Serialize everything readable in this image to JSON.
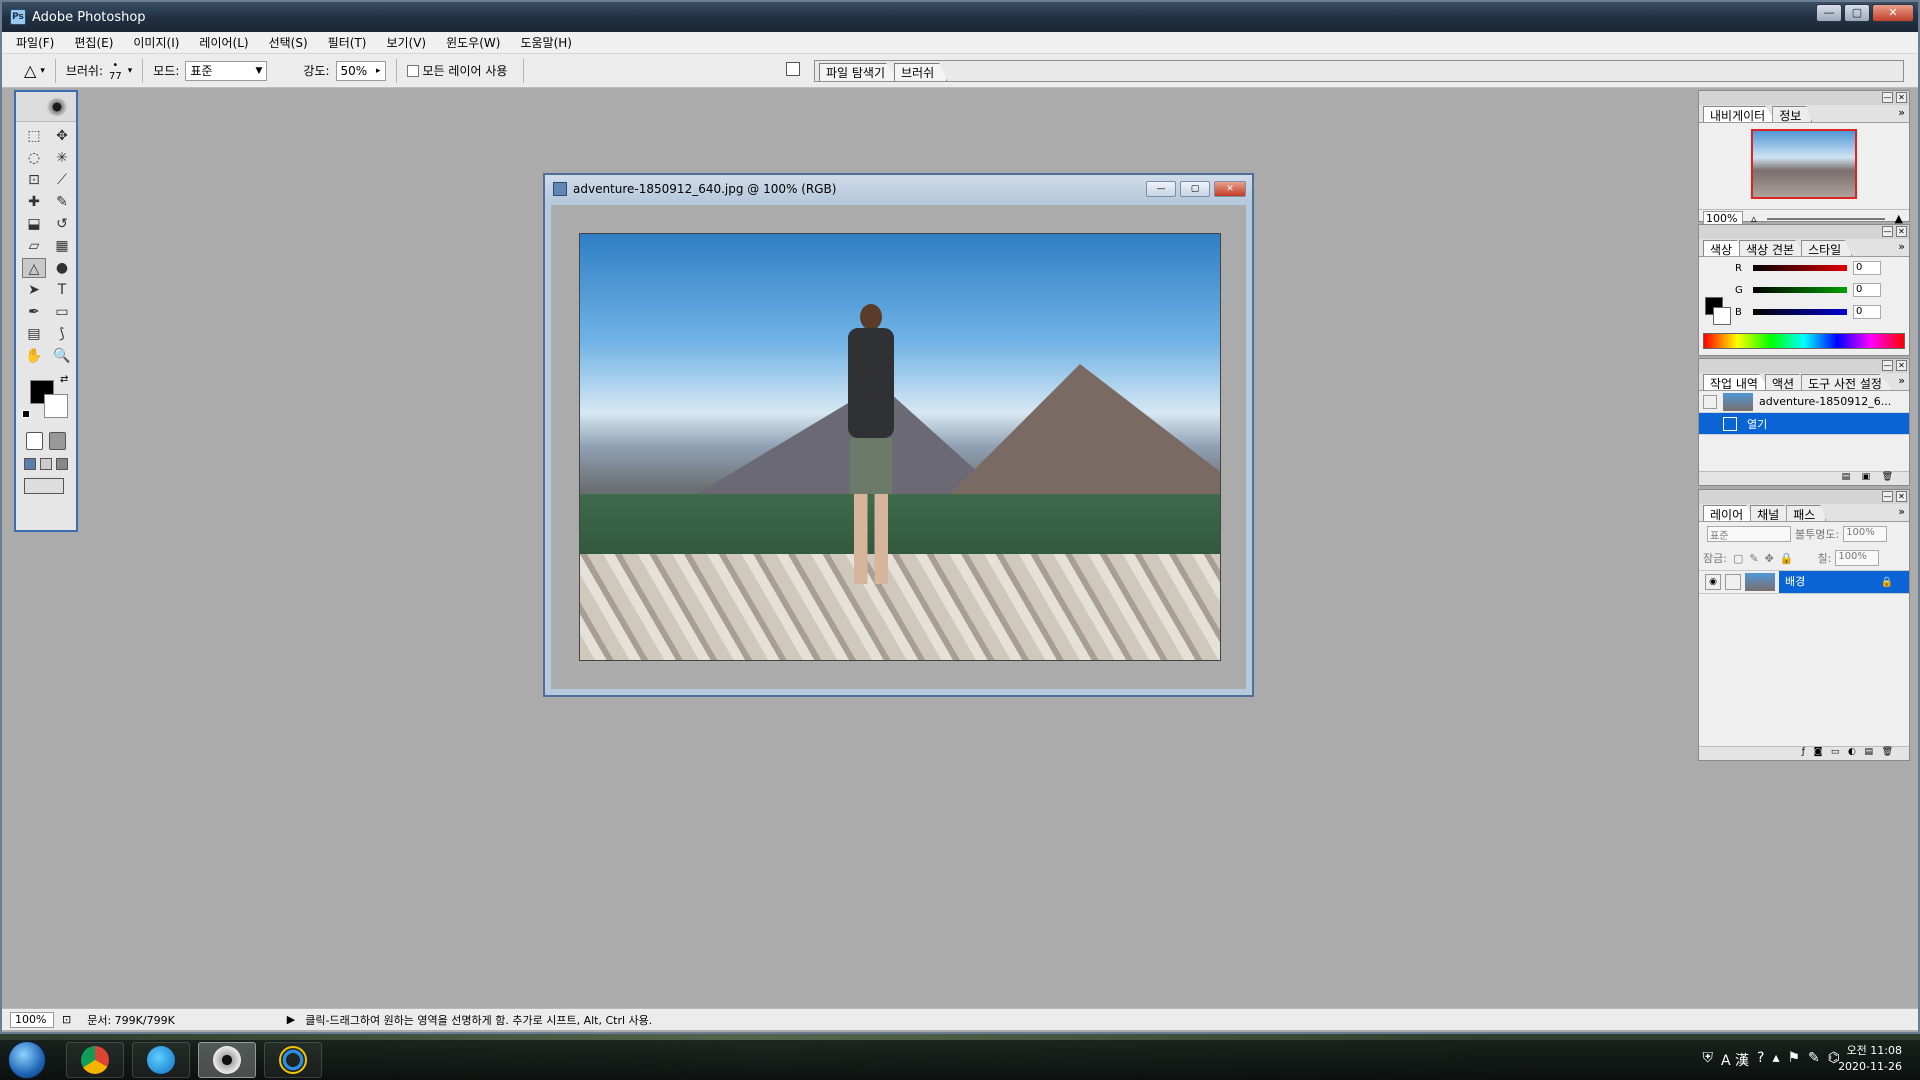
{
  "app": {
    "title": "Adobe Photoshop"
  },
  "menu": [
    "파일(F)",
    "편집(E)",
    "이미지(I)",
    "레이어(L)",
    "선택(S)",
    "필터(T)",
    "보기(V)",
    "윈도우(W)",
    "도움말(H)"
  ],
  "options": {
    "brush_label": "브러쉬:",
    "brush_size": "77",
    "mode_label": "모드:",
    "mode_value": "표준",
    "strength_label": "강도:",
    "strength_value": "50%",
    "all_layers_label": "모든 레이어 사용",
    "dock_tabs": [
      "파일 탐색기",
      "브러쉬"
    ]
  },
  "document": {
    "title": "adventure-1850912_640.jpg @ 100% (RGB)"
  },
  "panels": {
    "navigator": {
      "tabs": [
        "내비게이터",
        "정보"
      ],
      "zoom": "100%"
    },
    "color": {
      "tabs": [
        "색상",
        "색상 견본",
        "스타일"
      ],
      "channels": [
        {
          "label": "R",
          "value": "0",
          "color": "#e00000"
        },
        {
          "label": "G",
          "value": "0",
          "color": "#00a000"
        },
        {
          "label": "B",
          "value": "0",
          "color": "#0000d0"
        }
      ]
    },
    "history": {
      "tabs": [
        "작업 내역",
        "액션",
        "도구 사전 설정"
      ],
      "snapshot": "adventure-1850912_6...",
      "step": "열기"
    },
    "layers": {
      "tabs": [
        "레이어",
        "채널",
        "패스"
      ],
      "blend_mode": "표준",
      "opacity_label": "불투명도:",
      "opacity": "100%",
      "lock_label": "잠금:",
      "fill_label": "칠:",
      "fill": "100%",
      "layer_name": "배경"
    }
  },
  "status": {
    "zoom": "100%",
    "doc_size": "문서: 799K/799K",
    "hint": "클릭-드래그하여 원하는 영역을 선명하게 함. 추가로 시프트, Alt, Ctrl 사용."
  },
  "taskbar": {
    "clock_time": "오전 11:08",
    "clock_date": "2020-11-26",
    "ime": "A 漢"
  },
  "colors": {
    "selection": "#0a64d6",
    "titlebar": "#223244"
  }
}
